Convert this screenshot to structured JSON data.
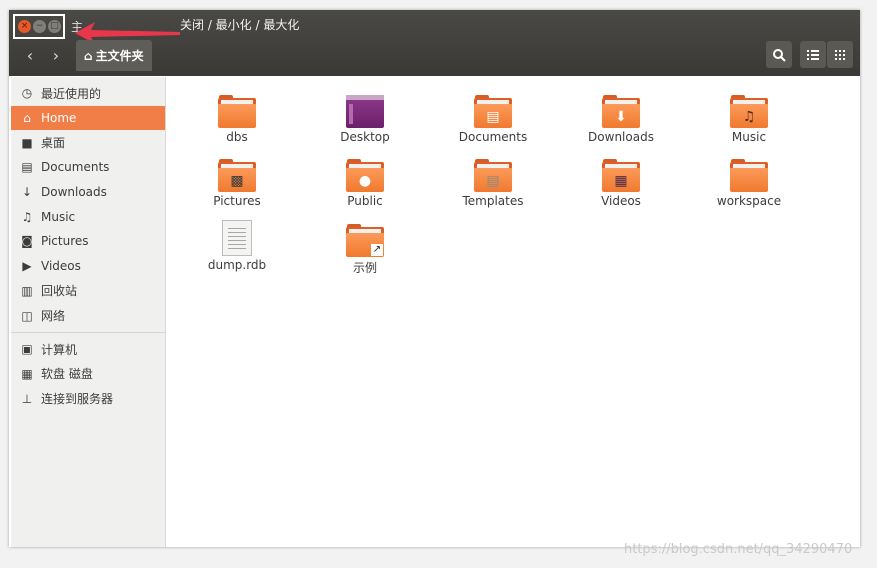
{
  "annotation": {
    "text": "关闭 / 最小化 / 最大化"
  },
  "titlebar": {
    "title_partial": "主"
  },
  "window_buttons": {
    "close": "×",
    "minimize": "−",
    "maximize": "□"
  },
  "navigation": {
    "back_icon": "‹",
    "forward_icon": "›"
  },
  "location": {
    "home_icon": "⌂",
    "label": "主文件夹"
  },
  "toolbar": {
    "search_icon": "search-icon",
    "list_view_icon": "list-icon",
    "grid_view_icon": "grid-icon"
  },
  "sidebar": {
    "groups": [
      [
        {
          "label": "最近使用的",
          "icon": "clock-icon"
        },
        {
          "label": "Home",
          "icon": "home-icon",
          "active": true
        },
        {
          "label": "桌面",
          "icon": "folder-icon"
        },
        {
          "label": "Documents",
          "icon": "document-icon"
        },
        {
          "label": "Downloads",
          "icon": "download-icon"
        },
        {
          "label": "Music",
          "icon": "music-icon"
        },
        {
          "label": "Pictures",
          "icon": "camera-icon"
        },
        {
          "label": "Videos",
          "icon": "video-icon"
        },
        {
          "label": "回收站",
          "icon": "trash-icon"
        },
        {
          "label": "网络",
          "icon": "network-icon"
        }
      ],
      [
        {
          "label": "计算机",
          "icon": "computer-icon"
        },
        {
          "label": "软盘 磁盘",
          "icon": "floppy-icon"
        },
        {
          "label": "连接到服务器",
          "icon": "server-icon"
        }
      ]
    ]
  },
  "files": [
    {
      "name": "dbs",
      "icon": "folder"
    },
    {
      "name": "Desktop",
      "icon": "desktop-folder"
    },
    {
      "name": "Documents",
      "icon": "documents-folder"
    },
    {
      "name": "Downloads",
      "icon": "downloads-folder"
    },
    {
      "name": "Music",
      "icon": "music-folder"
    },
    {
      "name": "Pictures",
      "icon": "pictures-folder"
    },
    {
      "name": "Public",
      "icon": "public-folder"
    },
    {
      "name": "Templates",
      "icon": "templates-folder"
    },
    {
      "name": "Videos",
      "icon": "videos-folder"
    },
    {
      "name": "workspace",
      "icon": "folder"
    },
    {
      "name": "dump.rdb",
      "icon": "text-file"
    },
    {
      "name": "示例",
      "icon": "link-folder"
    }
  ],
  "watermark": "https://blog.csdn.net/qq_34290470",
  "colors": {
    "accent": "#f07e46",
    "titlebar": "#3c3b37",
    "annotation_arrow": "#e8364a"
  }
}
